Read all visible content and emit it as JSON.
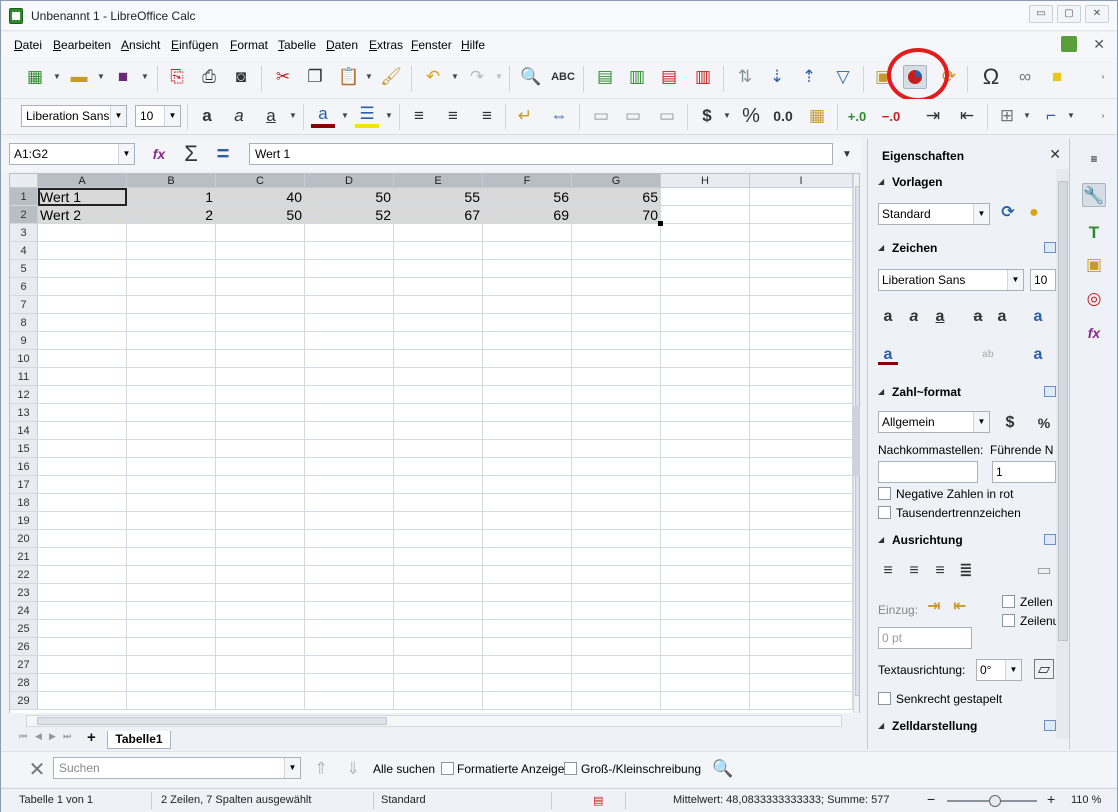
{
  "window": {
    "title": "Unbenannt 1 - LibreOffice Calc",
    "min_label": "▭",
    "max_label": "▢",
    "close_label": "✕"
  },
  "menubar": {
    "items": [
      "Datei",
      "Bearbeiten",
      "Ansicht",
      "Einfügen",
      "Format",
      "Tabelle",
      "Daten",
      "Extras",
      "Fenster",
      "Hilfe"
    ],
    "close_label": "✕"
  },
  "format_toolbar": {
    "font_name": "Liberation Sans",
    "font_size": "10",
    "currency_symbol": "$",
    "percent_symbol": "%",
    "decimal_label": "0.0"
  },
  "formula_bar": {
    "name_box": "A1:G2",
    "content": "Wert 1"
  },
  "sheet": {
    "columns": [
      "A",
      "B",
      "C",
      "D",
      "E",
      "F",
      "G",
      "H",
      "I"
    ],
    "selected_columns": [
      "A",
      "B",
      "C",
      "D",
      "E",
      "F",
      "G"
    ],
    "row_numbers": [
      "1",
      "2",
      "3",
      "4",
      "5",
      "6",
      "7",
      "8",
      "9",
      "10",
      "11",
      "12",
      "13",
      "14",
      "15",
      "16",
      "17",
      "18",
      "19",
      "20",
      "21",
      "22",
      "23",
      "24",
      "25",
      "26",
      "27",
      "28",
      "29"
    ],
    "rows": [
      [
        "Wert 1",
        "1",
        "40",
        "50",
        "55",
        "56",
        "65"
      ],
      [
        "Wert 2",
        "2",
        "50",
        "52",
        "67",
        "69",
        "70"
      ]
    ],
    "tab_name": "Tabelle1",
    "add_tab_label": "+"
  },
  "find_toolbar": {
    "search_placeholder": "Suchen",
    "find_all": "Alle suchen",
    "formatted_display": "Formatierte Anzeige",
    "match_case": "Groß-/Kleinschreibung"
  },
  "statusbar": {
    "sheet_position": "Tabelle 1 von 1",
    "selection_info": "2 Zeilen, 7 Spalten ausgewählt",
    "page_style": "Standard",
    "formula_summary": "Mittelwert: 48,0833333333333; Summe: 577",
    "zoom_minus": "−",
    "zoom_plus": "+",
    "zoom": "110 %"
  },
  "sidebar": {
    "title": "Eigenschaften",
    "close_label": "✕",
    "sections": {
      "styles": "Vorlagen",
      "character": "Zeichen",
      "number_format": "Zahl~format",
      "alignment": "Ausrichtung",
      "cell_appearance": "Zelldarstellung"
    },
    "style_value": "Standard",
    "font_name": "Liberation Sans",
    "font_size": "10",
    "number_category": "Allgemein",
    "currency_symbol": "$",
    "percent_symbol": "%",
    "decimal_places_label": "Nachkommastellen:",
    "leading_zeros_label": "Führende N",
    "leading_zeros_value": "1",
    "negative_red": "Negative Zahlen in rot",
    "thousands_sep": "Tausendertrennzeichen",
    "indent_label": "Einzug:",
    "indent_value": "0 pt",
    "merge_cells": "Zellen",
    "wrap_text": "Zeilenu",
    "text_orientation_label": "Textausrichtung:",
    "text_orientation_value": "0°",
    "stacked_vertically": "Senkrecht gestapelt"
  },
  "colors": {
    "accent_highlight": "#e51b1b",
    "selection_fill": "#d9d9d9",
    "header_selected": "#b9bec4"
  }
}
